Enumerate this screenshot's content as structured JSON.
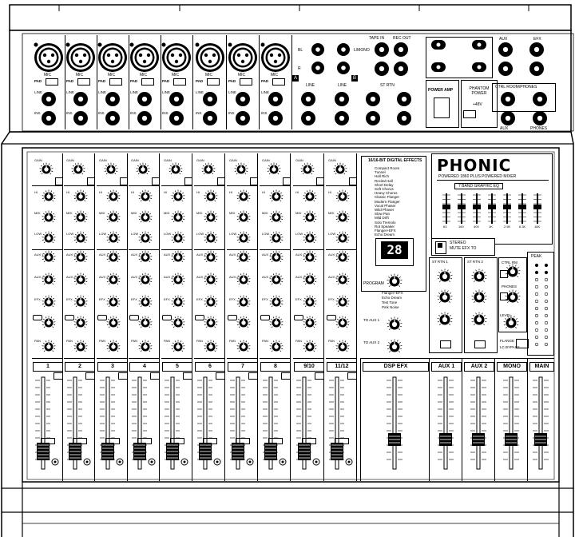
{
  "brand": {
    "name": "PHONIC",
    "tagline": "POWERED 1860 PLUS POWERED MIXER"
  },
  "rear_panel": {
    "channel_labels": [
      "MIC",
      "MIC",
      "MIC",
      "MIC",
      "MIC",
      "MIC",
      "MIC",
      "MIC"
    ],
    "pad_label": "PAD",
    "line_label": "LINE",
    "insert_label": "INS",
    "bl_labels": [
      "BL",
      "L/MONO",
      "R"
    ],
    "line_jacks_label": "LINE",
    "tape_in_label": "TAPE IN",
    "rec_out_label": "REC OUT",
    "st_rtn_label": "ST RTN",
    "power_amp_label": "POWER AMP",
    "phantom_label": "PHANTOM POWER",
    "phantom_value": "+48V",
    "aux_label": "AUX",
    "efx_label": "EFX",
    "ctrl_label": "CTRL ROOM/PHONES",
    "phones_label": "PHONES",
    "aux_out_label": "AUX",
    "main_label": "MAIN",
    "amp_out": [
      "A",
      "B"
    ]
  },
  "console": {
    "gain_label": "GAIN",
    "eq_labels": [
      "HI",
      "MID",
      "LOW"
    ],
    "aux_labels": [
      "AUX 1",
      "AUX 2",
      "EFX"
    ],
    "pan_label": "PAN",
    "channel_numbers": [
      "1",
      "2",
      "3",
      "4",
      "5",
      "6",
      "7",
      "8",
      "9/10",
      "11/12"
    ],
    "strip_labels": [
      "DSP EFX",
      "AUX 1",
      "AUX 2",
      "MONO",
      "MAIN"
    ],
    "effects_title": "16/16-BIT DIGITAL EFFECTS",
    "effects": [
      "Compact Room",
      "Tunnel",
      "Hall Rich",
      "Recital Hall",
      "Short Delay",
      "Soft Chorus",
      "Heavy Chorus",
      "Classic Flanger",
      "Modern Flanger",
      "Vocal Phaser",
      "Wild Phaser",
      "Slow Pan",
      "Mild Drift",
      "Solo Tremolo",
      "Rot Speaker",
      "Flanger+EFX",
      "Echo Dream",
      "Chorus+Verb",
      "Delay+Verb",
      "Chorus+Dly",
      "Plate+Delay",
      "Deep Verb"
    ],
    "effect_display": "28",
    "efx_footer": [
      "Flanger+EFX",
      "Echo Dream",
      "Test Tone",
      "Pink Noise"
    ],
    "program_label": "PROGRAM",
    "to_aux_labels": [
      "TO AUX 1",
      "TO AUX 2"
    ],
    "aux_return_labels": [
      "ST RTN 1",
      "ST RTN 2"
    ],
    "level_label": "LEVEL",
    "ctrl_room_label": "CTRL RM",
    "phones_label": "PHONES",
    "meter_label": "PEAK",
    "graphic_eq_label": "7 BAND GRAPHIC EQ",
    "eq_freqs": [
      "63",
      "160",
      "400",
      "1K",
      "2.5K",
      "6.3K",
      "16K"
    ],
    "stereo_label": "STEREO",
    "stereo_sub": "MUTE EFX TO",
    "switches": [
      "FLANGE",
      "LC BYPASS"
    ]
  }
}
